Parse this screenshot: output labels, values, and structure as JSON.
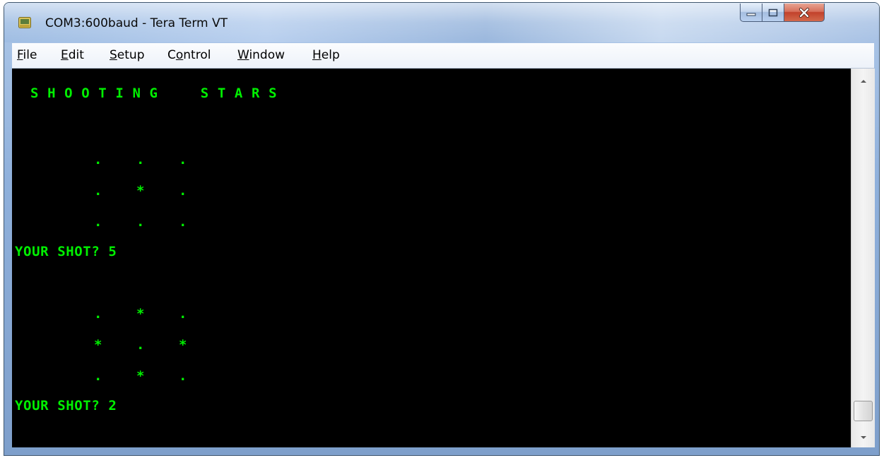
{
  "window": {
    "title": "COM3:600baud - Tera Term VT"
  },
  "menu": {
    "items": [
      {
        "mnemonic": "F",
        "rest": "ile"
      },
      {
        "mnemonic": "E",
        "rest": "dit"
      },
      {
        "mnemonic": "S",
        "rest": "etup"
      },
      {
        "pre": "C",
        "mnemonic": "o",
        "rest": "ntrol"
      },
      {
        "mnemonic": "W",
        "rest": "indow"
      },
      {
        "mnemonic": "H",
        "rest": "elp"
      }
    ]
  },
  "terminal": {
    "heading": "S H O O T I N G     S T A R S",
    "grid1": {
      "row1": [
        ".",
        ".",
        "."
      ],
      "row2": [
        ".",
        "*",
        "."
      ],
      "row3": [
        ".",
        ".",
        "."
      ]
    },
    "prompt1": "YOUR SHOT? 5",
    "grid2": {
      "row1": [
        ".",
        "*",
        "."
      ],
      "row2": [
        "*",
        ".",
        "*"
      ],
      "row3": [
        ".",
        "*",
        "."
      ]
    },
    "prompt2": "YOUR SHOT? 2",
    "text_color": "#00f000",
    "background_color": "#000000"
  },
  "icons": {
    "app_icon": "tera-term-icon",
    "minimize": "minimize-icon",
    "maximize": "maximize-icon",
    "close": "close-icon",
    "scroll_up": "scroll-up-icon",
    "scroll_down": "scroll-down-icon"
  }
}
